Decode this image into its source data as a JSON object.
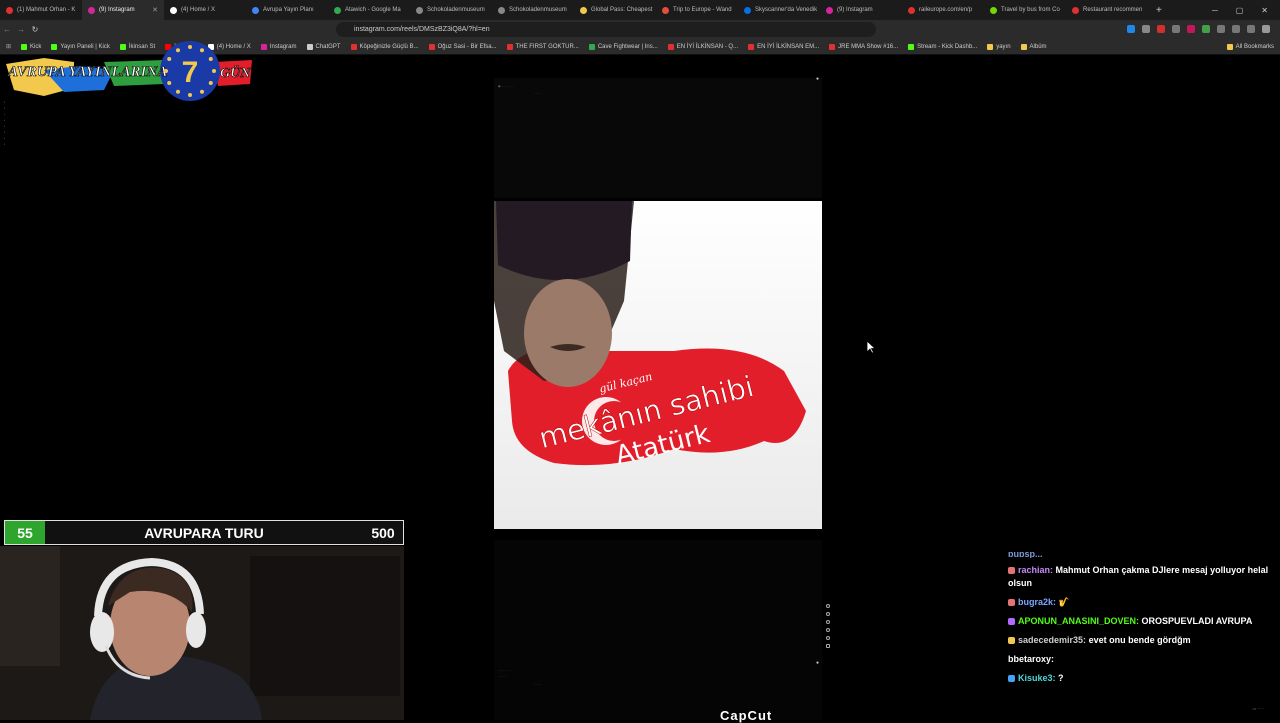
{
  "browser": {
    "tabs": [
      {
        "title": "(1) Mahmut Orhan - K",
        "color": "#e03030"
      },
      {
        "title": "(9) Instagram",
        "color": "#d6249f",
        "active": true
      },
      {
        "title": "(4) Home / X",
        "color": "#ffffff"
      },
      {
        "title": "Avrupa Yayın Planı",
        "color": "#4285f4"
      },
      {
        "title": "Atawich - Google Ma",
        "color": "#34a853"
      },
      {
        "title": "Schokoladenmuseum",
        "color": "#888888"
      },
      {
        "title": "Schokoladenmuseum",
        "color": "#888888"
      },
      {
        "title": "Global Pass: Cheapest",
        "color": "#f2c94c"
      },
      {
        "title": "Trip to Europe - Wand",
        "color": "#e74c3c"
      },
      {
        "title": "Skyscanner'da Venedik",
        "color": "#0770e3"
      },
      {
        "title": "(9) Instagram",
        "color": "#d6249f"
      },
      {
        "title": "raileurope.com/en/p",
        "color": "#e03030"
      },
      {
        "title": "Travel by bus from Co",
        "color": "#73d700"
      },
      {
        "title": "Restaurant recommen",
        "color": "#e03030"
      }
    ],
    "url": "instagram.com/reels/DMSzBZ3iQ8A/?hl=en",
    "bookmarks": [
      {
        "label": "Kick",
        "color": "#53fc18"
      },
      {
        "label": "Yayın Paneli | Kick",
        "color": "#53fc18"
      },
      {
        "label": "İkinsan St",
        "color": "#53fc18"
      },
      {
        "label": "YouTube",
        "color": "#ff0000"
      },
      {
        "label": "(4) Home / X",
        "color": "#ffffff"
      },
      {
        "label": "Instagram",
        "color": "#d6249f"
      },
      {
        "label": "ChatGPT",
        "color": "#cccccc"
      },
      {
        "label": "Köpeğinizle Güçlü B...",
        "color": "#e03030"
      },
      {
        "label": "Oğuz Sasi - Bir Efsa...",
        "color": "#e03030"
      },
      {
        "label": "THE FIRST GOKTUR...",
        "color": "#e03030"
      },
      {
        "label": "Cave Fightwear | Ins...",
        "color": "#34a853"
      },
      {
        "label": "EN İYİ İLKİNSAN - Q...",
        "color": "#e03030"
      },
      {
        "label": "EN İYİ İLKİNSAN EM...",
        "color": "#e03030"
      },
      {
        "label": "JRE MMA Show #16...",
        "color": "#e03030"
      },
      {
        "label": "Stream - Kick Dashb...",
        "color": "#53fc18"
      },
      {
        "label": "yayın",
        "color": "#f2c94c"
      },
      {
        "label": "Albüm",
        "color": "#f2c94c"
      }
    ],
    "all_bookmarks": "All Bookmarks"
  },
  "overlay": {
    "banner_text_left": "AVRUPA YAYINLARINA",
    "banner_number": "7",
    "banner_text_right": "GÜN",
    "score_left": "55",
    "score_title": "AVRUPARA TURU",
    "score_right": "500"
  },
  "video": {
    "line1": "gül kaçan",
    "line2": "mekânın sahibi",
    "line3": "Atatürk",
    "capcut": "CapCut"
  },
  "chat": {
    "cut_text": "bubsp...",
    "messages": [
      {
        "user": "rachian:",
        "user_color": "#c58af9",
        "badge_color": "#e57373",
        "text": "Mahmut Orhan çakma DJlere mesaj yolluyor helal olsun"
      },
      {
        "user": "bugra2k:",
        "user_color": "#7aa7ff",
        "badge_color": "#e57373",
        "text": "🎷"
      },
      {
        "user": "APONUN_ANASINI_DOVEN:",
        "user_color": "#53fc18",
        "badge_color": "#b36bff",
        "text": "OROSPUEVLADI AVRUPA"
      },
      {
        "user": "sadecedemir35:",
        "user_color": "#cfcfcf",
        "badge_color": "#f2c94c",
        "text": "evet onu bende gördğm"
      },
      {
        "user": "bbetaroxy:",
        "user_color": "#ffffff",
        "badge_color": "",
        "text": ""
      },
      {
        "user": "Kisuke3:",
        "user_color": "#4fd6d6",
        "badge_color": "#42a5f5",
        "text": "?"
      }
    ]
  },
  "colors": {
    "accent_green": "#2ea62e",
    "eu_blue": "#1a3aa8",
    "eu_star": "#f2c94c",
    "flag_red": "#e31e2b"
  }
}
